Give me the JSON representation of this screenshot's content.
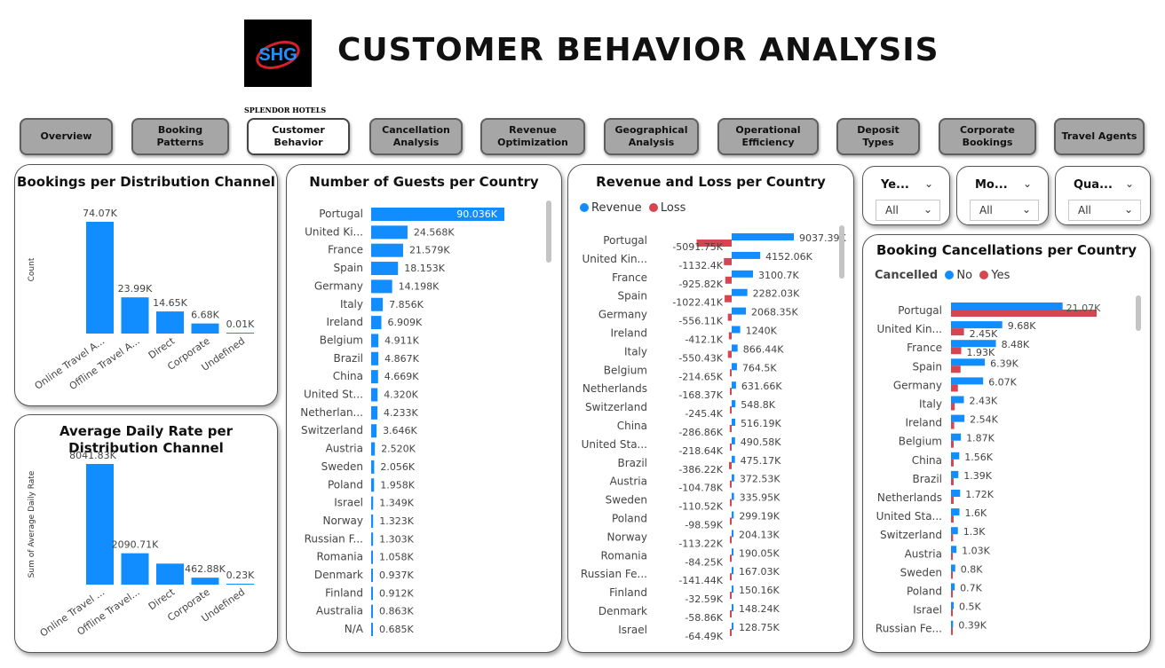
{
  "header": {
    "logo_text": "SHG",
    "logo_caption": "SPLENDOR HOTELS",
    "title": "CUSTOMER BEHAVIOR ANALYSIS"
  },
  "colors": {
    "blue": "#118dff",
    "red": "#d64550"
  },
  "nav": [
    {
      "line1": "Overview",
      "line2": "",
      "active": false
    },
    {
      "line1": "Booking",
      "line2": "Patterns",
      "active": false
    },
    {
      "line1": "Customer",
      "line2": "Behavior",
      "active": true
    },
    {
      "line1": "Cancellation",
      "line2": "Analysis",
      "active": false
    },
    {
      "line1": "Revenue",
      "line2": "Optimization",
      "active": false
    },
    {
      "line1": "Geographical",
      "line2": "Analysis",
      "active": false
    },
    {
      "line1": "Operational",
      "line2": "Efficiency",
      "active": false
    },
    {
      "line1": "Deposit",
      "line2": "Types",
      "active": false
    },
    {
      "line1": "Corporate",
      "line2": "Bookings",
      "active": false
    },
    {
      "line1": "Travel Agents",
      "line2": "",
      "active": false
    }
  ],
  "slicers": [
    {
      "title": "Ye...",
      "value": "All"
    },
    {
      "title": "Mo...",
      "value": "All"
    },
    {
      "title": "Qua...",
      "value": "All"
    }
  ],
  "legends": {
    "revenue_loss": [
      "Revenue",
      "Loss"
    ],
    "cancel_title": "Cancelled",
    "cancel": [
      "No",
      "Yes"
    ]
  },
  "chart_data": [
    {
      "type": "bar",
      "title": "Bookings per Distribution Channel",
      "ylabel": "Count",
      "categories": [
        "Online Travel A...",
        "Offline Travel A...",
        "Direct",
        "Corporate",
        "Undefined"
      ],
      "values": [
        74070,
        23990,
        14650,
        6680,
        10
      ],
      "labels": [
        "74.07K",
        "23.99K",
        "14.65K",
        "6.68K",
        "0.01K"
      ]
    },
    {
      "type": "bar",
      "title": "Average Daily Rate per Distribution Channel",
      "ylabel": "Sum of Average Daily Rate",
      "categories": [
        "Online Travel ...",
        "Offline Travel...",
        "Direct",
        "Corporate",
        "Undefined"
      ],
      "values": [
        8041.83,
        2090.71,
        1400,
        462.88,
        0.23
      ],
      "labels": [
        "8041.83K",
        "2090.71K",
        "",
        "462.88K",
        "0.23K"
      ]
    },
    {
      "type": "bar",
      "orientation": "horizontal",
      "title": "Number of Guests per Country",
      "categories": [
        "Portugal",
        "United Ki...",
        "France",
        "Spain",
        "Germany",
        "Italy",
        "Ireland",
        "Belgium",
        "Brazil",
        "China",
        "United St...",
        "Netherlan...",
        "Switzerland",
        "Austria",
        "Sweden",
        "Poland",
        "Israel",
        "Norway",
        "Russian F...",
        "Romania",
        "Denmark",
        "Finland",
        "Australia",
        "N/A"
      ],
      "values": [
        90.036,
        24.568,
        21.579,
        18.153,
        14.198,
        7.856,
        6.909,
        4.911,
        4.867,
        4.669,
        4.32,
        4.233,
        3.646,
        2.52,
        2.056,
        1.958,
        1.349,
        1.323,
        1.303,
        1.058,
        0.937,
        0.912,
        0.863,
        0.685
      ],
      "labels": [
        "90.036K",
        "24.568K",
        "21.579K",
        "18.153K",
        "14.198K",
        "7.856K",
        "6.909K",
        "4.911K",
        "4.867K",
        "4.669K",
        "4.320K",
        "4.233K",
        "3.646K",
        "2.520K",
        "2.056K",
        "1.958K",
        "1.349K",
        "1.323K",
        "1.303K",
        "1.058K",
        "0.937K",
        "0.912K",
        "0.863K",
        "0.685K"
      ]
    },
    {
      "type": "bar",
      "orientation": "horizontal",
      "title": "Revenue and Loss per Country",
      "categories": [
        "Portugal",
        "United Kin...",
        "France",
        "Spain",
        "Germany",
        "Ireland",
        "Italy",
        "Belgium",
        "Netherlands",
        "Switzerland",
        "China",
        "United Sta...",
        "Brazil",
        "Austria",
        "Sweden",
        "Poland",
        "Norway",
        "Romania",
        "Russian Fe...",
        "Finland",
        "Denmark",
        "Israel"
      ],
      "series": [
        {
          "name": "Revenue",
          "values": [
            9037.39,
            4152.06,
            3100.7,
            2282.03,
            2068.35,
            1240,
            866.44,
            764.5,
            631.66,
            548.8,
            516.19,
            490.58,
            475.17,
            372.53,
            335.95,
            299.19,
            204.13,
            190.05,
            167.03,
            150.16,
            148.24,
            128.75
          ],
          "labels": [
            "9037.39K",
            "4152.06K",
            "3100.7K",
            "2282.03K",
            "2068.35K",
            "1240K",
            "866.44K",
            "764.5K",
            "631.66K",
            "548.8K",
            "516.19K",
            "490.58K",
            "475.17K",
            "372.53K",
            "335.95K",
            "299.19K",
            "204.13K",
            "190.05K",
            "167.03K",
            "150.16K",
            "148.24K",
            "128.75K"
          ]
        },
        {
          "name": "Loss",
          "values": [
            -5091.75,
            -1132.4,
            -925.82,
            -1022.41,
            -556.11,
            -412.1,
            -550.43,
            -214.65,
            -168.37,
            -245.4,
            -286.86,
            -218.64,
            -386.22,
            -104.78,
            -110.52,
            -98.59,
            -113.22,
            -84.25,
            -141.44,
            -32.59,
            -58.86,
            -64.49
          ],
          "labels": [
            "-5091.75K",
            "-1132.4K",
            "-925.82K",
            "-1022.41K",
            "-556.11K",
            "-412.1K",
            "-550.43K",
            "-214.65K",
            "-168.37K",
            "-245.4K",
            "-286.86K",
            "-218.64K",
            "-386.22K",
            "-104.78K",
            "-110.52K",
            "-98.59K",
            "-113.22K",
            "-84.25K",
            "-141.44K",
            "-32.59K",
            "-58.86K",
            "-64.49K"
          ]
        }
      ]
    },
    {
      "type": "bar",
      "orientation": "horizontal",
      "title": "Booking Cancellations per Country",
      "categories": [
        "Portugal",
        "United Kin...",
        "France",
        "Spain",
        "Germany",
        "Italy",
        "Ireland",
        "Belgium",
        "China",
        "Brazil",
        "Netherlands",
        "United Sta...",
        "Switzerland",
        "Austria",
        "Sweden",
        "Poland",
        "Israel",
        "Russian Fe..."
      ],
      "series": [
        {
          "name": "No",
          "values": [
            21.07,
            9.68,
            8.48,
            6.39,
            6.07,
            2.43,
            2.54,
            1.87,
            1.56,
            1.39,
            1.72,
            1.6,
            1.3,
            1.03,
            0.8,
            0.7,
            0.5,
            0.39
          ],
          "labels": [
            "",
            "9.68K",
            "8.48K",
            "6.39K",
            "6.07K",
            "2.43K",
            "2.54K",
            "1.87K",
            "1.56K",
            "1.39K",
            "1.72K",
            "1.6K",
            "1.3K",
            "1.03K",
            "0.8K",
            "0.7K",
            "0.5K",
            "0.39K"
          ]
        },
        {
          "name": "Yes",
          "values": [
            27.5,
            2.45,
            1.93,
            1.8,
            1.3,
            0.7,
            0.6,
            0.5,
            0.5,
            0.5,
            0.5,
            0.5,
            0.4,
            0.3,
            0.2,
            0.2,
            0.2,
            0.15
          ],
          "labels": [
            "21.07K",
            "2.45K",
            "1.93K",
            "",
            "",
            "",
            "",
            "",
            "",
            "",
            "",
            "",
            "",
            "",
            "",
            "",
            "",
            ""
          ]
        }
      ]
    }
  ]
}
